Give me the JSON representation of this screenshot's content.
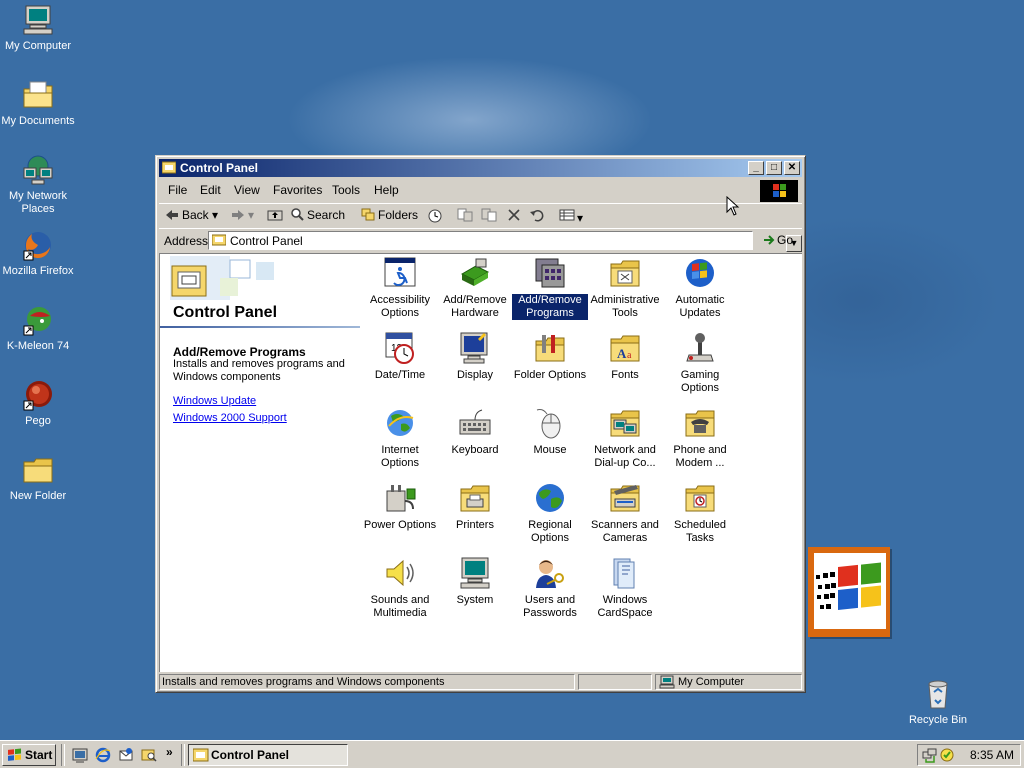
{
  "desktop": {
    "icons": [
      {
        "label": "My Computer",
        "icon": "computer-icon"
      },
      {
        "label": "My Documents",
        "icon": "documents-folder-icon"
      },
      {
        "label": "My Network Places",
        "icon": "network-places-icon"
      },
      {
        "label": "Mozilla Firefox",
        "icon": "firefox-icon"
      },
      {
        "label": "K-Meleon 74",
        "icon": "k-meleon-icon"
      },
      {
        "label": "Pego",
        "icon": "pego-icon"
      },
      {
        "label": "New Folder",
        "icon": "folder-icon"
      },
      {
        "label": "Recycle Bin",
        "icon": "recycle-bin-icon"
      }
    ]
  },
  "window": {
    "title": "Control Panel",
    "menu": [
      "File",
      "Edit",
      "View",
      "Favorites",
      "Tools",
      "Help"
    ],
    "toolbar": {
      "back": "Back",
      "search": "Search",
      "folders": "Folders"
    },
    "address": {
      "label": "Address",
      "value": "Control Panel",
      "go": "Go"
    },
    "left_pane": {
      "title": "Control Panel",
      "selected_title": "Add/Remove Programs",
      "selected_description": "Installs and removes programs and Windows components",
      "links": [
        "Windows Update",
        "Windows 2000 Support"
      ]
    },
    "items": [
      {
        "label": "Accessibility Options",
        "icon": "accessibility-icon"
      },
      {
        "label": "Add/Remove Hardware",
        "icon": "hardware-icon"
      },
      {
        "label": "Add/Remove Programs",
        "icon": "programs-icon",
        "selected": true
      },
      {
        "label": "Administrative Tools",
        "icon": "admin-tools-icon"
      },
      {
        "label": "Automatic Updates",
        "icon": "windows-update-icon"
      },
      {
        "label": "Date/Time",
        "icon": "calendar-clock-icon"
      },
      {
        "label": "Display",
        "icon": "display-icon"
      },
      {
        "label": "Folder Options",
        "icon": "folder-options-icon"
      },
      {
        "label": "Fonts",
        "icon": "fonts-icon"
      },
      {
        "label": "Gaming Options",
        "icon": "joystick-icon"
      },
      {
        "label": "Internet Options",
        "icon": "internet-options-icon"
      },
      {
        "label": "Keyboard",
        "icon": "keyboard-icon"
      },
      {
        "label": "Mouse",
        "icon": "mouse-icon"
      },
      {
        "label": "Network and Dial-up Co...",
        "icon": "network-icon"
      },
      {
        "label": "Phone and Modem ...",
        "icon": "phone-icon"
      },
      {
        "label": "Power Options",
        "icon": "power-icon"
      },
      {
        "label": "Printers",
        "icon": "printer-icon"
      },
      {
        "label": "Regional Options",
        "icon": "globe-icon"
      },
      {
        "label": "Scanners and Cameras",
        "icon": "scanner-icon"
      },
      {
        "label": "Scheduled Tasks",
        "icon": "scheduled-tasks-icon"
      },
      {
        "label": "Sounds and Multimedia",
        "icon": "speaker-icon"
      },
      {
        "label": "System",
        "icon": "system-icon"
      },
      {
        "label": "Users and Passwords",
        "icon": "users-icon"
      },
      {
        "label": "Windows CardSpace",
        "icon": "cardspace-icon"
      }
    ],
    "status": {
      "text": "Installs and removes programs and Windows components",
      "zone": "My Computer"
    }
  },
  "taskbar": {
    "start": "Start",
    "active_task": "Control Panel",
    "clock": "8:35 AM"
  },
  "colors": {
    "desktop": "#3a6ea5",
    "titlebar_start": "#0a246a",
    "titlebar_end": "#a6caf0",
    "selection": "#0a246a",
    "chrome": "#d4d0c8",
    "link": "#0000ee"
  }
}
